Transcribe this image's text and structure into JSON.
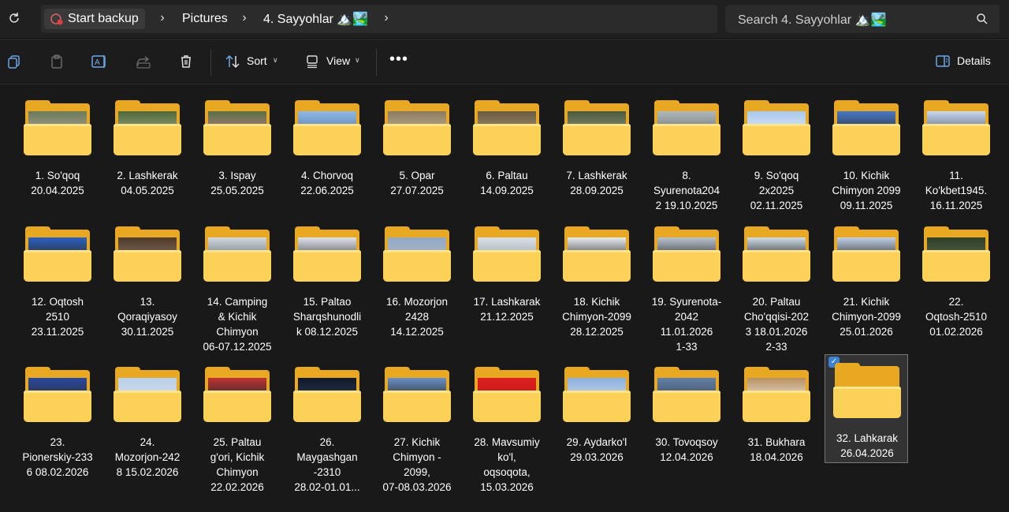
{
  "address": {
    "crumbs": [
      "Start backup",
      "Pictures",
      "4. Sayyohlar 🏔️🏞️"
    ]
  },
  "search": {
    "placeholder": "Search 4. Sayyohlar 🏔️🏞️"
  },
  "toolbar": {
    "sort_label": "Sort",
    "view_label": "View",
    "more_label": "•••",
    "details_label": "Details"
  },
  "folders": [
    {
      "label": "1. So'qoq\n20.04.2025",
      "photo": [
        "#6a7a5a",
        "#a8a090"
      ]
    },
    {
      "label": "2. Lashkerak\n04.05.2025",
      "photo": [
        "#4f6a3a",
        "#9aa080"
      ]
    },
    {
      "label": "3. Ispay\n25.05.2025",
      "photo": [
        "#5a6f45",
        "#b08080"
      ]
    },
    {
      "label": "4. Chorvoq\n22.06.2025",
      "photo": [
        "#8fb8e8",
        "#5d7fa8"
      ]
    },
    {
      "label": "5. Opar\n27.07.2025",
      "photo": [
        "#8a7a60",
        "#c0b090"
      ]
    },
    {
      "label": "6. Paltau\n14.09.2025",
      "photo": [
        "#6a5a40",
        "#a09070"
      ]
    },
    {
      "label": "7. Lashkerak\n28.09.2025",
      "photo": [
        "#4a5a40",
        "#8a9070"
      ]
    },
    {
      "label": "8.\nSyurenota204\n2 19.10.2025",
      "photo": [
        "#b0b8c0",
        "#707870"
      ]
    },
    {
      "label": "9. So'qoq\n2x2025\n02.11.2025",
      "photo": [
        "#a8c8f0",
        "#e0e8f0"
      ]
    },
    {
      "label": "10. Kichik\nChimyon 2099\n09.11.2025",
      "photo": [
        "#4878c8",
        "#303040"
      ]
    },
    {
      "label": "11.\nKo'kbet1945.\n16.11.2025",
      "photo": [
        "#c8d8f0",
        "#606878"
      ]
    },
    {
      "label": "12. Oqtosh\n2510\n23.11.2025",
      "photo": [
        "#2a60c0",
        "#303030"
      ]
    },
    {
      "label": "13.\nQoraqiyasoy\n30.11.2025",
      "photo": [
        "#503828",
        "#807060"
      ]
    },
    {
      "label": "14. Camping\n& Kichik\nChimyon\n06-07.12.2025",
      "photo": [
        "#d0d8e0",
        "#707880"
      ]
    },
    {
      "label": "15. Paltao\nSharqshunodli\nk 08.12.2025",
      "photo": [
        "#e0e4ea",
        "#505058"
      ]
    },
    {
      "label": "16. Mozorjon\n2428\n14.12.2025",
      "photo": [
        "#90a8c8",
        "#b0b8c0"
      ]
    },
    {
      "label": "17. Lashkarak\n21.12.2025",
      "photo": [
        "#d8e0e8",
        "#a0a8b0"
      ]
    },
    {
      "label": "18. Kichik\nChimyon-2099\n28.12.2025",
      "photo": [
        "#e8ecf0",
        "#404040"
      ]
    },
    {
      "label": "19. Syurenota-\n2042\n11.01.2026\n1-33",
      "photo": [
        "#b8c4d0",
        "#383838"
      ]
    },
    {
      "label": "20. Paltau\nCho'qqisi-202\n3 18.01.2026\n2-33",
      "photo": [
        "#d0dce8",
        "#303030"
      ]
    },
    {
      "label": "21. Kichik\nChimyon-2099\n25.01.2026",
      "photo": [
        "#c0d0e8",
        "#383838"
      ]
    },
    {
      "label": "22.\nOqtosh-2510\n01.02.2026",
      "photo": [
        "#304028",
        "#506048"
      ]
    },
    {
      "label": "23.\nPionerskiy-233\n6 08.02.2026",
      "photo": [
        "#2848a0",
        "#303038"
      ]
    },
    {
      "label": "24.\nMozorjon-242\n8 15.02.2026",
      "photo": [
        "#b8d0ec",
        "#d8dce4"
      ]
    },
    {
      "label": "25. Paltau\ng'ori, Kichik\nChimyon\n22.02.2026",
      "photo": [
        "#c03030",
        "#303030"
      ]
    },
    {
      "label": "26.\nMaygashgan\n-2310\n28.02-01.01...",
      "photo": [
        "#101828",
        "#2a3550"
      ]
    },
    {
      "label": "27. Kichik\nChimyon -\n2099,\n07-08.03.2026",
      "photo": [
        "#6890c8",
        "#303030"
      ]
    },
    {
      "label": "28. Mavsumiy\nko'l,\noqsoqota,\n15.03.2026",
      "photo": [
        "#e02020",
        "#c01818"
      ]
    },
    {
      "label": "29. Aydarko'l\n29.03.2026",
      "photo": [
        "#8ab0e0",
        "#c8d4e0"
      ]
    },
    {
      "label": "30. Tovoqsoy\n12.04.2026",
      "photo": [
        "#6080a8",
        "#485060"
      ]
    },
    {
      "label": "31. Bukhara\n18.04.2026",
      "photo": [
        "#b89060",
        "#e8e0d0"
      ]
    },
    {
      "label": "32. Lahkarak\n26.04.2026",
      "photo": null,
      "selected": true
    }
  ]
}
